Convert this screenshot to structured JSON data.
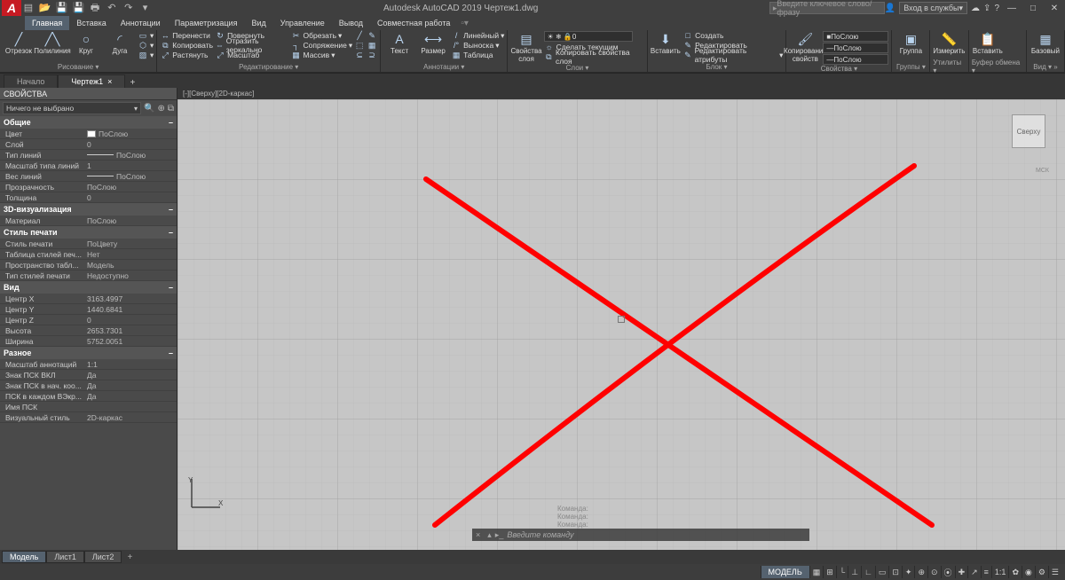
{
  "title": "Autodesk AutoCAD 2019   Чертеж1.dwg",
  "search_placeholder": "Введите ключевое слово/фразу",
  "login_label": "Вход в службы",
  "menubar": {
    "tabs": [
      "Главная",
      "Вставка",
      "Аннотации",
      "Параметризация",
      "Вид",
      "Управление",
      "Вывод",
      "Совместная работа"
    ],
    "active": 0
  },
  "ribbon": {
    "draw": {
      "label": "Рисование ▾",
      "items": [
        "Отрезок",
        "Полилиния",
        "Круг",
        "Дуга"
      ]
    },
    "edit": {
      "label": "Редактирование ▾",
      "rows": [
        [
          "↔",
          "Перенести",
          "↻",
          "Повернуть",
          "✂",
          "Обрезать"
        ],
        [
          "⧉",
          "Копировать",
          "⇔",
          "Отразить зеркально",
          "┐",
          "Сопряжение"
        ],
        [
          "⤢",
          "Растянуть",
          "⤢",
          "Масштаб",
          "▦",
          "Массив"
        ]
      ]
    },
    "annot": {
      "label": "Аннотации ▾",
      "items": [
        "Текст",
        "Размер"
      ],
      "rows": [
        [
          "/",
          "Линейный"
        ],
        [
          "/°",
          "Выноска"
        ],
        [
          "▦",
          "Таблица"
        ]
      ]
    },
    "layers": {
      "label": "Слои ▾",
      "big": "Свойства слоя",
      "selected": "0",
      "rows": [
        [
          "☼",
          "Сделать текущим"
        ],
        [
          "⧉",
          "Копировать свойства слоя"
        ]
      ]
    },
    "block": {
      "label": "Блок ▾",
      "big": "Вставить",
      "rows": [
        [
          "□",
          "Создать"
        ],
        [
          "✎",
          "Редактировать"
        ],
        [
          "✎",
          "Редактировать атрибуты"
        ]
      ]
    },
    "props": {
      "label": "Свойства ▾",
      "big": "Копирование свойств",
      "combo1": "ПоСлою",
      "combo2": "ПоСлою",
      "combo3": "ПоСлою"
    },
    "groups": {
      "label": "Группы ▾",
      "item": "Группа"
    },
    "utils": {
      "label": "Утилиты ▾",
      "item": "Измерить"
    },
    "clip": {
      "label": "Буфер обмена ▾",
      "item": "Вставить"
    },
    "view": {
      "label": "Вид ▾ »",
      "item": "Базовый"
    }
  },
  "doctabs": {
    "items": [
      "Начало",
      "Чертеж1"
    ],
    "active": 1,
    "close": "×",
    "add": "+"
  },
  "viewport_label": "[-][Сверху][2D-каркас]",
  "viewcube_face": "Сверху",
  "wcs_label": "МСК",
  "ucs": {
    "x": "X",
    "y": "Y"
  },
  "properties": {
    "title": "СВОЙСТВА",
    "nothing": "Ничего не выбрано",
    "cats": [
      {
        "name": "Общие",
        "rows": [
          {
            "k": "Цвет",
            "v": "ПоСлою",
            "swatch": true
          },
          {
            "k": "Слой",
            "v": "0"
          },
          {
            "k": "Тип линий",
            "v": "ПоСлою",
            "line": true
          },
          {
            "k": "Масштаб типа линий",
            "v": "1"
          },
          {
            "k": "Вес линий",
            "v": "ПоСлою",
            "line": true
          },
          {
            "k": "Прозрачность",
            "v": "ПоСлою"
          },
          {
            "k": "Толщина",
            "v": "0"
          }
        ]
      },
      {
        "name": "3D-визуализация",
        "rows": [
          {
            "k": "Материал",
            "v": "ПоСлою"
          }
        ]
      },
      {
        "name": "Стиль печати",
        "rows": [
          {
            "k": "Стиль печати",
            "v": "ПоЦвету"
          },
          {
            "k": "Таблица стилей печ...",
            "v": "Нет"
          },
          {
            "k": "Пространство табл...",
            "v": "Модель"
          },
          {
            "k": "Тип стилей печати",
            "v": "Недоступно"
          }
        ]
      },
      {
        "name": "Вид",
        "rows": [
          {
            "k": "Центр X",
            "v": "3163.4997"
          },
          {
            "k": "Центр Y",
            "v": "1440.6841"
          },
          {
            "k": "Центр Z",
            "v": "0"
          },
          {
            "k": "Высота",
            "v": "2653.7301"
          },
          {
            "k": "Ширина",
            "v": "5752.0051"
          }
        ]
      },
      {
        "name": "Разное",
        "rows": [
          {
            "k": "Масштаб аннотаций",
            "v": "1:1"
          },
          {
            "k": "Знак ПСК ВКЛ",
            "v": "Да"
          },
          {
            "k": "Знак ПСК в нач. коо...",
            "v": "Да"
          },
          {
            "k": "ПСК в каждом ВЭкр...",
            "v": "Да"
          },
          {
            "k": "Имя ПСК",
            "v": ""
          },
          {
            "k": "Визуальный стиль",
            "v": "2D-каркас"
          }
        ]
      }
    ]
  },
  "command": {
    "history": [
      "Команда:",
      "Команда:",
      "Команда:"
    ],
    "placeholder": "Введите команду"
  },
  "layout_tabs": {
    "items": [
      "Модель",
      "Лист1",
      "Лист2"
    ],
    "active": 0
  },
  "status": {
    "model": "МОДЕЛЬ",
    "buttons": [
      "▦",
      "⊞",
      "└",
      "⊥",
      "∟",
      "▭",
      "⊡",
      "✦",
      "⊕",
      "⊙",
      "⦿",
      "✚",
      "↗",
      "≡",
      "1:1",
      "✿",
      "◉",
      "⚙",
      "☰"
    ]
  }
}
